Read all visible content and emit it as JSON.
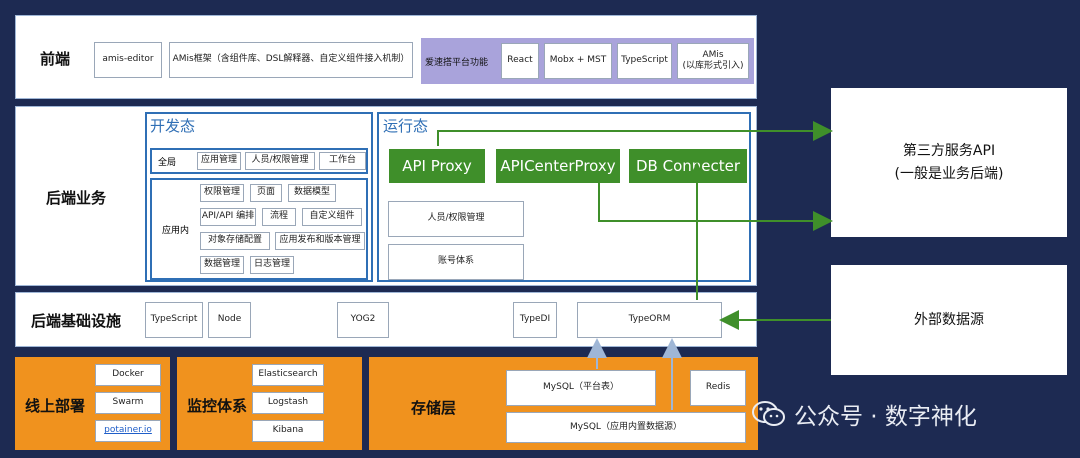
{
  "frontend": {
    "label": "前端",
    "amis_editor": "amis-editor",
    "amis_framework": "AMis框架（含组件库、DSL解释器、自定义组件接入机制）",
    "platform_features": "爱速搭平台功能",
    "react": "React",
    "mobx": "Mobx + MST",
    "typescript": "TypeScript",
    "amis_lib_line1": "AMis",
    "amis_lib_line2": "(以库形式引入)"
  },
  "backend": {
    "label": "后端业务",
    "dev": {
      "title": "开发态",
      "global_label": "全局",
      "global_items": [
        "应用管理",
        "人员/权限管理",
        "工作台"
      ],
      "inapp_label": "应用内",
      "inapp_items": [
        "权限管理",
        "页面",
        "数据模型",
        "API/API 编排",
        "流程",
        "自定义组件",
        "对象存储配置",
        "应用发布和版本管理",
        "数据管理",
        "日志管理"
      ]
    },
    "runtime": {
      "title": "运行态",
      "api_proxy": "API Proxy",
      "api_center_proxy": "APICenterProxy",
      "db_connecter": "DB Connecter",
      "people": "人员/权限管理",
      "account": "账号体系"
    }
  },
  "infra": {
    "label": "后端基础设施",
    "typescript": "TypeScript",
    "node": "Node",
    "yog2": "YOG2",
    "typedi": "TypeDI",
    "typeorm": "TypeORM"
  },
  "deploy": {
    "label": "线上部署",
    "items": [
      "Docker",
      "Swarm",
      "potainer.io"
    ]
  },
  "monitor": {
    "label": "监控体系",
    "items": [
      "Elasticsearch",
      "Logstash",
      "Kibana"
    ]
  },
  "storage": {
    "label": "存储层",
    "mysql_platform": "MySQL（平台表）",
    "redis": "Redis",
    "mysql_app": "MySQL（应用内置数据源）"
  },
  "third_party": {
    "line1": "第三方服务API",
    "line2": "(一般是业务后端)"
  },
  "external": {
    "label": "外部数据源"
  },
  "watermark": "公众号 · 数字神化",
  "colors": {
    "background": "#1d2a52",
    "green": "#3f8f2a",
    "orange": "#f0921e",
    "purple": "#a9a3db",
    "blue": "#2f6fb5"
  }
}
